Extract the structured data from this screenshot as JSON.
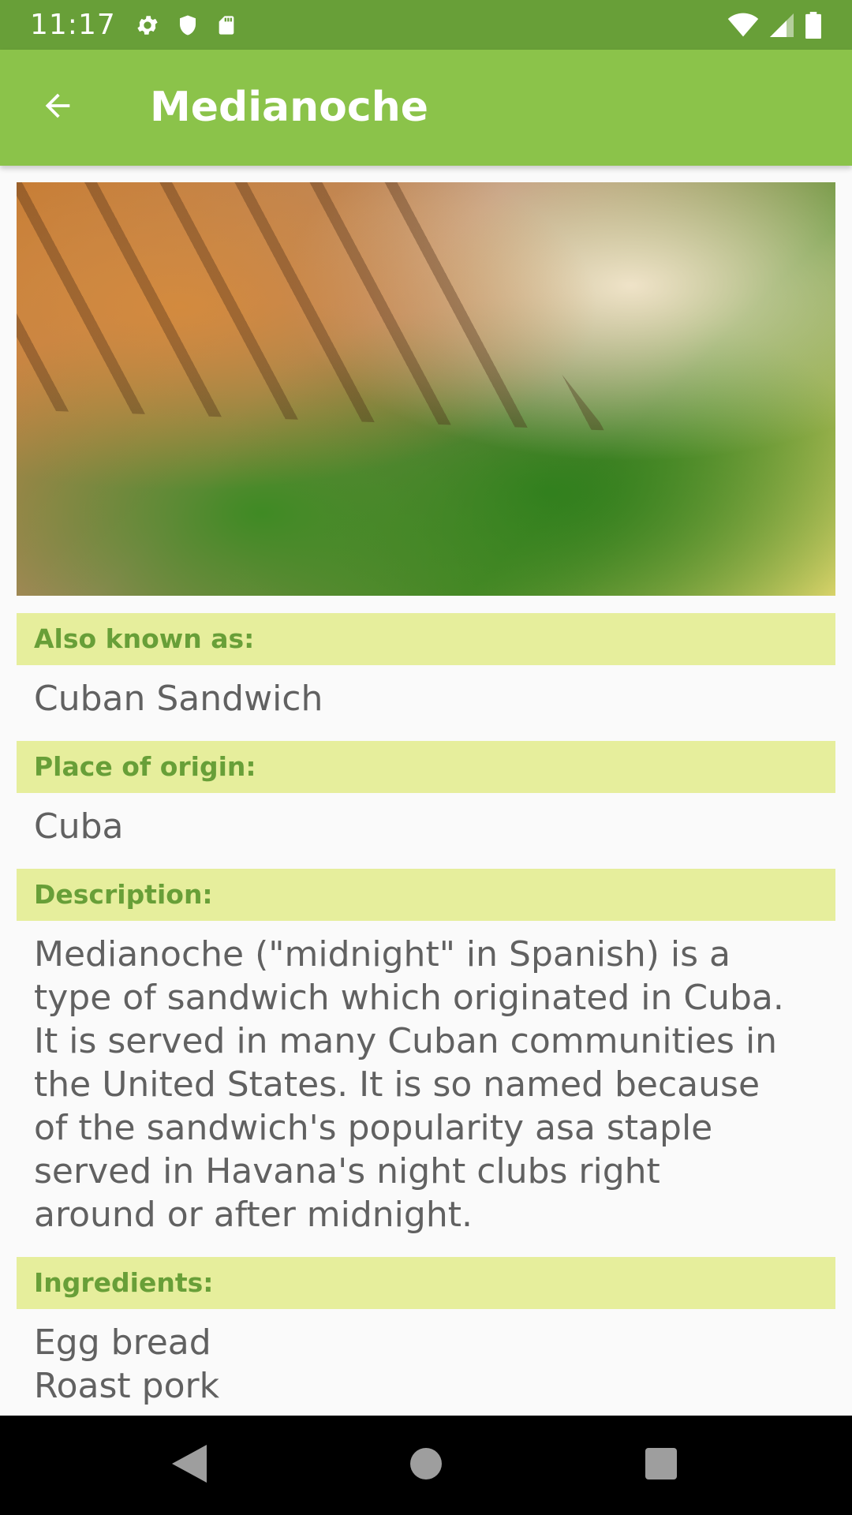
{
  "status_bar": {
    "time": "11:17",
    "icons_left": [
      "settings-icon",
      "shield-icon",
      "sd-card-icon"
    ],
    "icons_right": [
      "wifi-icon",
      "signal-icon",
      "battery-icon"
    ]
  },
  "app_bar": {
    "back_icon": "arrow-back-icon",
    "title": "Medianoche"
  },
  "sections": [
    {
      "header": "Also known as:",
      "text": "Cuban Sandwich"
    },
    {
      "header": "Place of origin:",
      "text": "Cuba"
    },
    {
      "header": "Description:",
      "text": "Medianoche (\"midnight\" in Spanish) is a type of sandwich which originated in Cuba. It is served in many Cuban communities in the United States. It is so named because of the sandwich's popularity asa staple served in Havana's night clubs right around or after midnight."
    },
    {
      "header": "Ingredients:",
      "text": "Egg bread\nRoast pork"
    }
  ],
  "nav_bar": {
    "buttons": [
      "nav-back-icon",
      "nav-home-icon",
      "nav-recents-icon"
    ]
  },
  "colors": {
    "status_bar": "#689f38",
    "app_bar": "#8bc34a",
    "section_header_bg": "#e6ee9c",
    "section_header_text": "#689f38",
    "body_text": "#616161"
  }
}
